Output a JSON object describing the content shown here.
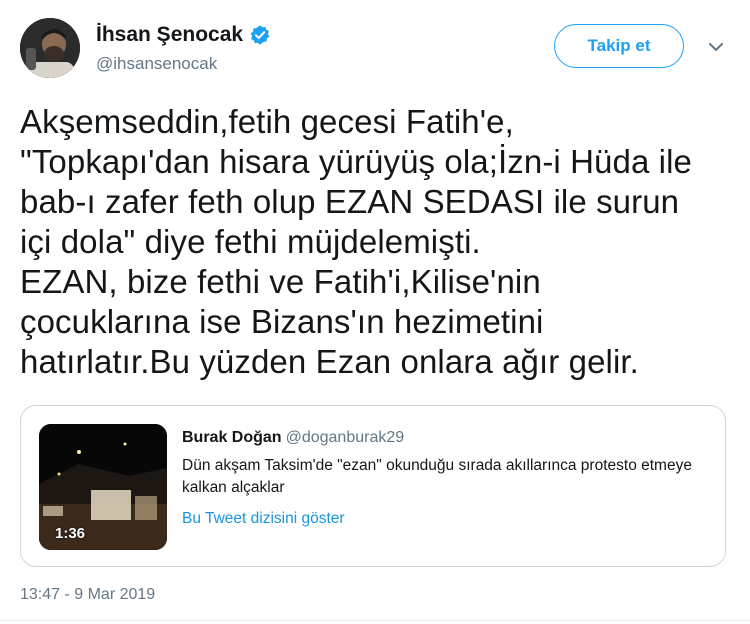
{
  "author": {
    "name": "İhsan Şenocak",
    "handle": "@ihsansenocak",
    "avatar_icon": "profile-photo",
    "verified_icon": "verified-badge-icon"
  },
  "actions": {
    "follow_label": "Takip et",
    "more_icon": "chevron-down-icon"
  },
  "tweet": {
    "lines": [
      "Akşemseddin,fetih gecesi Fatih'e,",
      "\"Topkapı'dan hisara yürüyüş ola;İzn-i Hüda ile",
      "bab-ı zafer feth olup EZAN SEDASI ile surun",
      "içi dola\" diye fethi müjdelemişti.",
      "EZAN, bize fethi ve Fatih'i,Kilise'nin",
      "çocuklarına ise Bizans'ın hezimetini",
      "hatırlatır.Bu yüzden Ezan onlara ağır gelir."
    ]
  },
  "quoted": {
    "name": "Burak Doğan",
    "handle": "@doganburak29",
    "text": "Dün akşam Taksim'de \"ezan\" okunduğu sırada akıllarınca protesto etmeye kalkan alçaklar",
    "thread_link": "Bu Tweet dizisini göster",
    "video_duration": "1:36"
  },
  "timestamp": "13:47 - 9 Mar 2019",
  "colors": {
    "accent": "#1da1f2",
    "link": "#1b95e0",
    "muted": "#657786",
    "border": "#ccd6dd"
  }
}
